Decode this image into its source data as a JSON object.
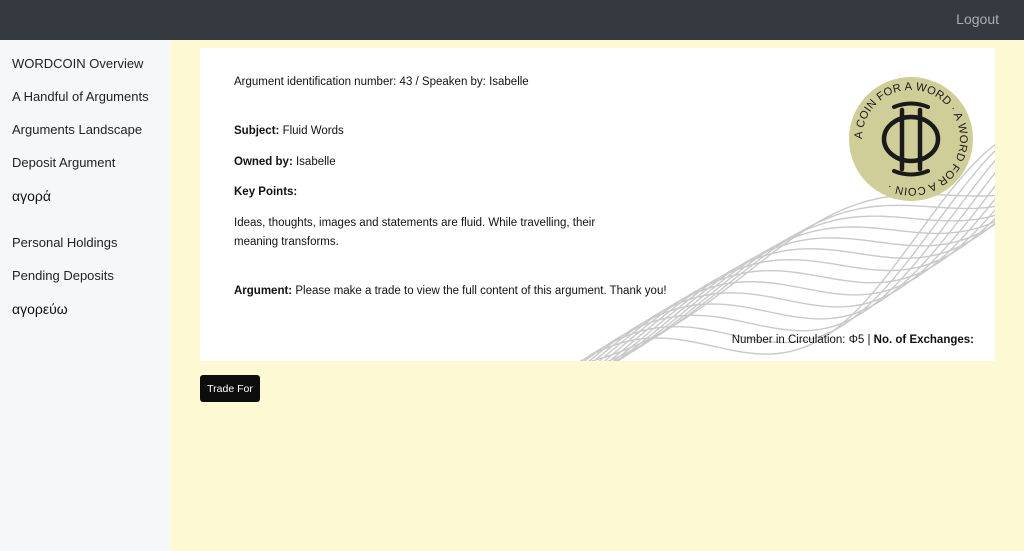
{
  "header": {
    "logout_label": "Logout"
  },
  "sidebar": {
    "items": [
      {
        "label": "WORDCOIN Overview"
      },
      {
        "label": "A Handful of Arguments"
      },
      {
        "label": "Arguments Landscape"
      },
      {
        "label": "Deposit Argument"
      },
      {
        "label": "αγορά"
      },
      {
        "label": "Personal Holdings"
      },
      {
        "label": "Pending Deposits"
      },
      {
        "label": "αγορεύω"
      }
    ]
  },
  "argument": {
    "id_line": "Argument identification number: 43 / Speaken by: Isabelle",
    "subject_label": "Subject:",
    "subject_value": "Fluid Words",
    "owner_label": "Owned by:",
    "owner_value": "Isabelle",
    "keypoints_label": "Key Points:",
    "keypoints_text": "Ideas, thoughts, images and statements are fluid. While travelling, their meaning transforms.",
    "argument_label": "Argument:",
    "argument_text": "Please make a trade to view the full content of this argument. Thank you!",
    "circulation_label": "Number in Circulation:",
    "circulation_value": "Φ5",
    "separator": "|",
    "exchanges_label": "No. of Exchanges:"
  },
  "coin": {
    "ring_text": "A COIN FOR A WORD · A WORD FOR A COIN · ",
    "fill_color": "#cfcd98"
  },
  "actions": {
    "trade_label": "Trade For"
  }
}
